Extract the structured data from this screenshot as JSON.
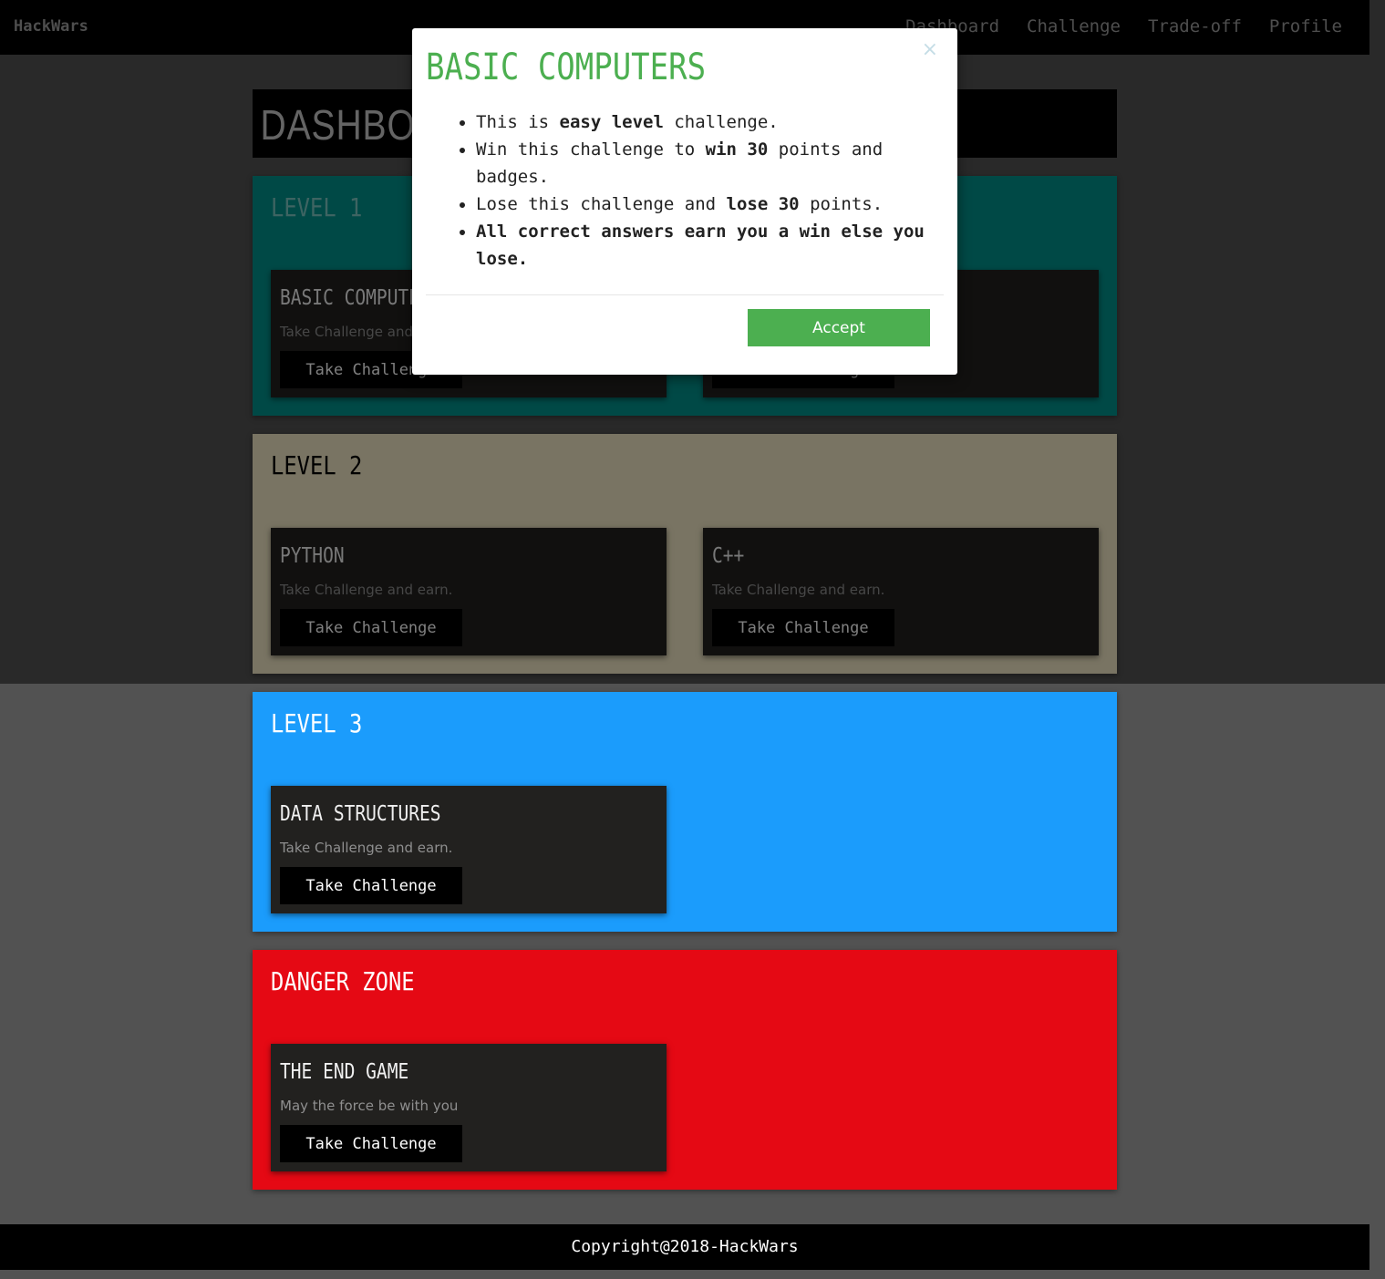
{
  "navbar": {
    "brand": "HackWars",
    "links": [
      "Dashboard",
      "Challenge",
      "Trade-off",
      "Profile"
    ]
  },
  "dashboard": {
    "title": "DASHBOARD"
  },
  "levels": [
    {
      "title": "LEVEL 1",
      "color": "#00938d",
      "title_color": "#7cc9c5",
      "cards": [
        {
          "title": "BASIC COMPUTERS",
          "text": "Take Challenge and earn.",
          "button": "Take Challenge"
        },
        {
          "title": "",
          "text": "",
          "button": "Take Challenge"
        }
      ]
    },
    {
      "title": "LEVEL 2",
      "color": "#f2e8c6",
      "title_color": "#000000",
      "cards": [
        {
          "title": "PYTHON",
          "text": "Take Challenge and earn.",
          "button": "Take Challenge"
        },
        {
          "title": "C++",
          "text": "Take Challenge and earn.",
          "button": "Take Challenge"
        }
      ]
    },
    {
      "title": "LEVEL 3",
      "color": "#1b9cfc",
      "title_color": "#ffffff",
      "cards": [
        {
          "title": "DATA STRUCTURES",
          "text": "Take Challenge and earn.",
          "button": "Take Challenge"
        }
      ]
    },
    {
      "title": "DANGER ZONE",
      "color": "#e50914",
      "title_color": "#ffffff",
      "cards": [
        {
          "title": "THE END GAME",
          "text": "May the force be with you",
          "button": "Take Challenge"
        }
      ]
    }
  ],
  "modal": {
    "title": "BASIC COMPUTERS",
    "close": "×",
    "rules": [
      [
        "This is ",
        "easy level",
        " challenge."
      ],
      [
        "Win this challenge to ",
        "win 30",
        " points and badges."
      ],
      [
        "Lose this challenge and ",
        "lose 30",
        " points."
      ],
      [
        "",
        "All correct answers earn you a win else you lose.",
        ""
      ]
    ],
    "accept": "Accept"
  },
  "footer": {
    "copyright": "Copyright@2018-HackWars"
  }
}
